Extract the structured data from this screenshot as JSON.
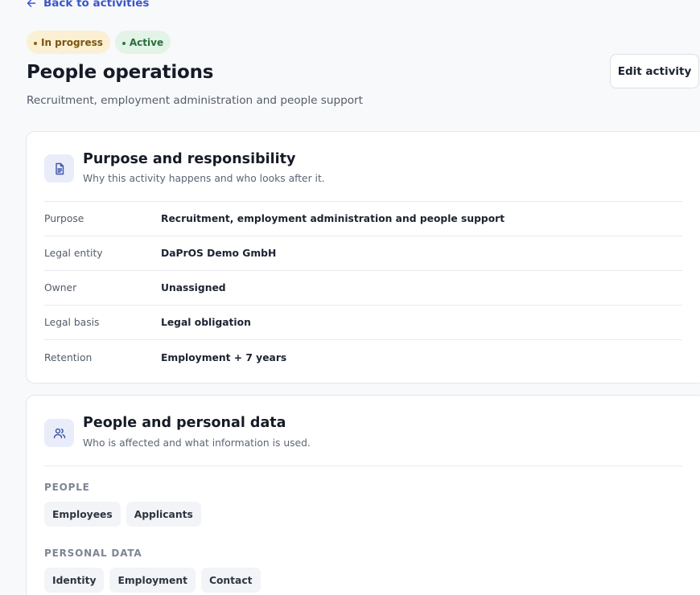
{
  "header": {
    "back_label": "Back to activities",
    "badges": [
      "In progress",
      "Active"
    ],
    "title": "People operations",
    "subtitle": "Recruitment, employment administration and people support",
    "edit_label": "Edit activity"
  },
  "purpose_card": {
    "icon": "document-icon",
    "title": "Purpose and responsibility",
    "description": "Why this activity happens and who looks after it.",
    "rows": [
      {
        "label": "Purpose",
        "value": "Recruitment, employment administration and people support"
      },
      {
        "label": "Legal entity",
        "value": "DaPrOS Demo GmbH"
      },
      {
        "label": "Owner",
        "value": "Unassigned"
      },
      {
        "label": "Legal basis",
        "value": "Legal obligation"
      },
      {
        "label": "Retention",
        "value": "Employment + 7 years"
      }
    ]
  },
  "people_card": {
    "icon": "users-icon",
    "title": "People and personal data",
    "description": "Who is affected and what information is used.",
    "people_label": "PEOPLE",
    "people": [
      "Employees",
      "Applicants"
    ],
    "data_label": "PERSONAL DATA",
    "data": [
      "Identity",
      "Employment",
      "Contact"
    ]
  },
  "colors": {
    "accent": "#3a57c9",
    "progress_badge_bg": "#fbf0d3",
    "active_badge_bg": "#e3f3e7"
  }
}
